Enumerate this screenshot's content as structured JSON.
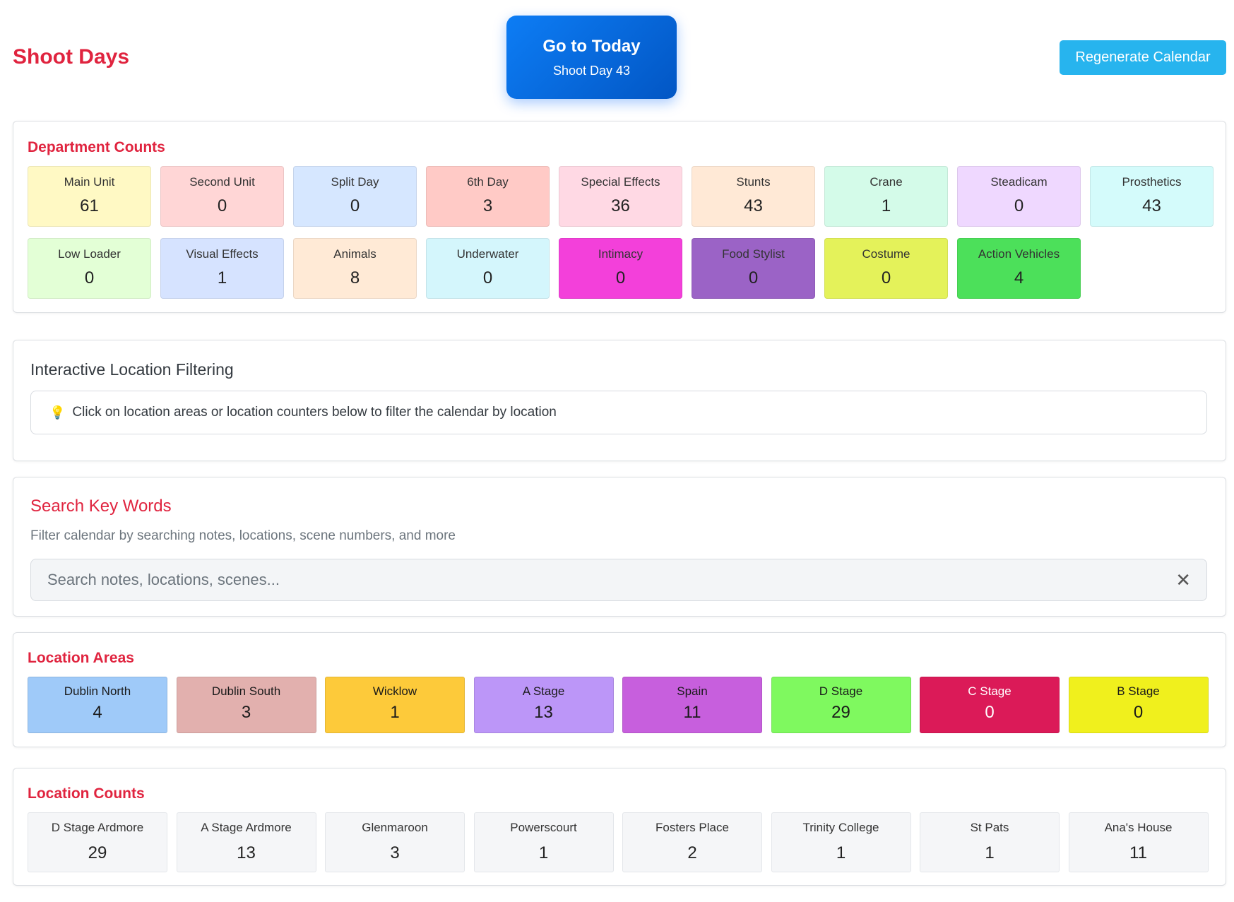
{
  "header": {
    "title": "Shoot Days",
    "today_button": {
      "label": "Go to Today",
      "sub_label": "Shoot Day 43"
    },
    "regenerate_label": "Regenerate Calendar"
  },
  "department_counts": {
    "title": "Department Counts",
    "items": [
      {
        "label": "Main Unit",
        "value": "61",
        "color": "#fff9c4",
        "text_color": "#333333"
      },
      {
        "label": "Second Unit",
        "value": "0",
        "color": "#ffd6d6",
        "text_color": "#333333"
      },
      {
        "label": "Split Day",
        "value": "0",
        "color": "#d6e7ff",
        "text_color": "#333333"
      },
      {
        "label": "6th Day",
        "value": "3",
        "color": "#ffcac6",
        "text_color": "#333333"
      },
      {
        "label": "Special Effects",
        "value": "36",
        "color": "#ffd9e4",
        "text_color": "#333333"
      },
      {
        "label": "Stunts",
        "value": "43",
        "color": "#ffe9d6",
        "text_color": "#333333"
      },
      {
        "label": "Crane",
        "value": "1",
        "color": "#d4fbe9",
        "text_color": "#333333"
      },
      {
        "label": "Steadicam",
        "value": "0",
        "color": "#efd8ff",
        "text_color": "#333333"
      },
      {
        "label": "Prosthetics",
        "value": "43",
        "color": "#d4fbfb",
        "text_color": "#333333"
      },
      {
        "label": "Low Loader",
        "value": "0",
        "color": "#e3ffd6",
        "text_color": "#333333"
      },
      {
        "label": "Visual Effects",
        "value": "1",
        "color": "#d6e3ff",
        "text_color": "#333333"
      },
      {
        "label": "Animals",
        "value": "8",
        "color": "#ffead6",
        "text_color": "#333333"
      },
      {
        "label": "Underwater",
        "value": "0",
        "color": "#d4f6fc",
        "text_color": "#333333"
      },
      {
        "label": "Intimacy",
        "value": "0",
        "color": "#f340da",
        "text_color": "#333333"
      },
      {
        "label": "Food Stylist",
        "value": "0",
        "color": "#9b63c6",
        "text_color": "#333333"
      },
      {
        "label": "Costume",
        "value": "0",
        "color": "#e4f25a",
        "text_color": "#333333"
      },
      {
        "label": "Action Vehicles",
        "value": "4",
        "color": "#4ce05a",
        "text_color": "#333333"
      }
    ]
  },
  "location_filtering": {
    "title": "Interactive Location Filtering",
    "hint": "Click on location areas or location counters below to filter the calendar by location",
    "hint_icon": "lightbulb-icon"
  },
  "search": {
    "title": "Search Key Words",
    "subtitle": "Filter calendar by searching notes, locations, scene numbers, and more",
    "placeholder": "Search notes, locations, scenes...",
    "clear_icon": "✕"
  },
  "location_areas": {
    "title": "Location Areas",
    "items": [
      {
        "label": "Dublin North",
        "value": "4",
        "color": "#9fcaf9",
        "text_color": "#1a1a1a"
      },
      {
        "label": "Dublin South",
        "value": "3",
        "color": "#e2b0ae",
        "text_color": "#1a1a1a"
      },
      {
        "label": "Wicklow",
        "value": "1",
        "color": "#fdca3a",
        "text_color": "#1a1a1a"
      },
      {
        "label": "A Stage",
        "value": "13",
        "color": "#bc96f8",
        "text_color": "#1a1a1a"
      },
      {
        "label": "Spain",
        "value": "11",
        "color": "#c75fdd",
        "text_color": "#1a1a1a"
      },
      {
        "label": "D Stage",
        "value": "29",
        "color": "#7ff95f",
        "text_color": "#1a1a1a"
      },
      {
        "label": "C Stage",
        "value": "0",
        "color": "#db1a58",
        "text_color": "#ffffff"
      },
      {
        "label": "B Stage",
        "value": "0",
        "color": "#f0f01d",
        "text_color": "#1a1a1a"
      }
    ]
  },
  "location_counts": {
    "title": "Location Counts",
    "items": [
      {
        "label": "D Stage Ardmore",
        "value": "29"
      },
      {
        "label": "A Stage Ardmore",
        "value": "13"
      },
      {
        "label": "Glenmaroon",
        "value": "3"
      },
      {
        "label": "Powerscourt",
        "value": "1"
      },
      {
        "label": "Fosters Place",
        "value": "2"
      },
      {
        "label": "Trinity College",
        "value": "1"
      },
      {
        "label": "St Pats",
        "value": "1"
      },
      {
        "label": "Ana's House",
        "value": "11"
      }
    ]
  },
  "colors": {
    "accent": "#e0243f",
    "primary_button": "#0d6efd",
    "info_button": "#27b4ee"
  }
}
